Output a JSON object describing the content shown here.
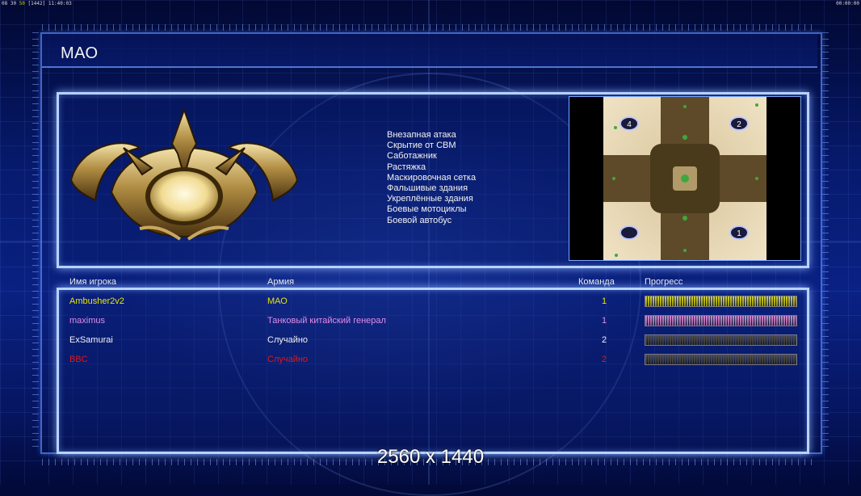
{
  "status_bar": {
    "left_prefix": "08 30",
    "left_fps": "50",
    "left_suffix": "[1442] 11:40:03",
    "right": "00:00:00"
  },
  "title": "МАО",
  "features": [
    "Внезапная атака",
    "Скрытие от СВМ",
    "Саботажник",
    "Растяжка",
    "Маскировочная сетка",
    "Фальшивые здания",
    "Укреплённые здания",
    "Боевые мотоциклы",
    "Боевой автобус"
  ],
  "minimap": {
    "start_positions": [
      "4",
      "2",
      "",
      "1"
    ]
  },
  "players_table": {
    "headers": {
      "name": "Имя игрока",
      "army": "Армия",
      "team": "Команда",
      "progress": "Прогресс"
    },
    "rows": [
      {
        "name": "Ambusher2v2",
        "army": "МАО",
        "team": "1",
        "color": "#e6e600",
        "progress": 1.0,
        "bar_color": "#d8d820"
      },
      {
        "name": "maximus",
        "army": "Танковый китайский генерал",
        "team": "1",
        "color": "#e08ce8",
        "progress": 1.0,
        "bar_color": "#d68ad6"
      },
      {
        "name": "ExSamurai",
        "army": "Случайно",
        "team": "2",
        "color": "#f2f2f2",
        "progress": 1.0,
        "bar_color": "#505050"
      },
      {
        "name": "BBC",
        "army": "Случайно",
        "team": "2",
        "color": "#e01818",
        "progress": 1.0,
        "bar_color": "#505050"
      }
    ]
  },
  "resolution_label": "2560 x 1440"
}
